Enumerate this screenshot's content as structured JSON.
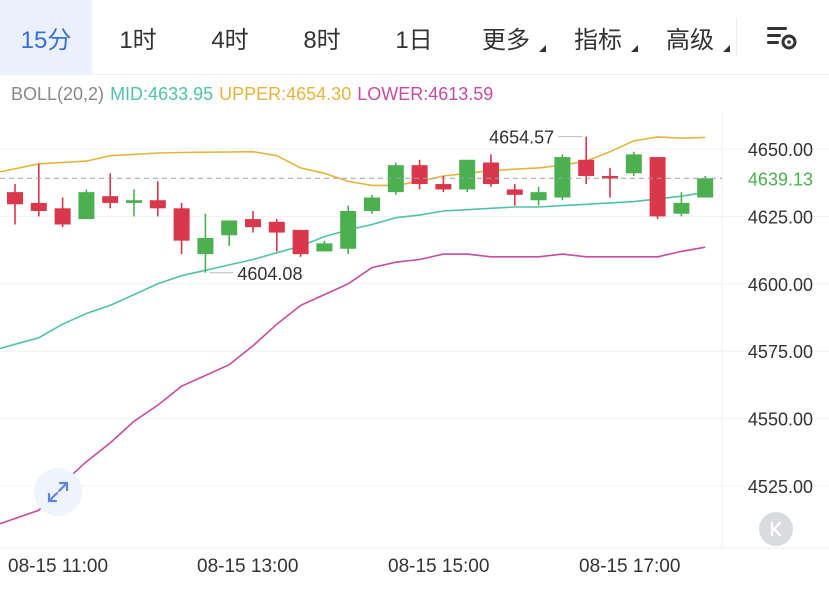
{
  "tabs": [
    {
      "label": "15分",
      "active": true,
      "dropdown": false
    },
    {
      "label": "1时",
      "active": false,
      "dropdown": false
    },
    {
      "label": "4时",
      "active": false,
      "dropdown": false
    },
    {
      "label": "8时",
      "active": false,
      "dropdown": false
    },
    {
      "label": "1日",
      "active": false,
      "dropdown": false
    },
    {
      "label": "更多",
      "active": false,
      "dropdown": true
    },
    {
      "label": "指标",
      "active": false,
      "dropdown": true
    },
    {
      "label": "高级",
      "active": false,
      "dropdown": true
    }
  ],
  "settings_icon": "chart-settings-icon",
  "indicator": {
    "name": "BOLL(20,2)",
    "mid": "MID:4633.95",
    "upper": "UPPER:4654.30",
    "lower": "LOWER:4613.59"
  },
  "colors": {
    "up": "#4caf50",
    "down": "#d9374b",
    "mid": "#4fc3a9",
    "upper": "#e8b33c",
    "lower": "#c84aa3",
    "active_tab": "#3b6fd8",
    "price_badge_text": "#4caf50"
  },
  "expand_icon": "expand-arrows-icon",
  "k_button": {
    "label": "K",
    "icon": "k-chevron-icon"
  },
  "chart_data": {
    "type": "candlestick",
    "y_ticks": [
      "4650.00",
      "4625.00",
      "4600.00",
      "4575.00",
      "4550.00",
      "4525.00"
    ],
    "y_tick_values": [
      4650,
      4625,
      4600,
      4575,
      4550,
      4525
    ],
    "ylim": [
      4510,
      4665
    ],
    "x_labels": [
      "08-15 11:00",
      "08-15 13:00",
      "08-15 15:00",
      "08-15 17:00"
    ],
    "x_label_index": [
      0,
      8,
      16,
      24
    ],
    "last_price": "4639.13",
    "last_price_value": 4639.13,
    "annotations": {
      "high": {
        "text": "4654.57",
        "index": 24,
        "value": 4654.57
      },
      "low": {
        "text": "4604.08",
        "index": 8,
        "value": 4604.08
      }
    },
    "candles": [
      {
        "o": 4634.0,
        "h": 4637.0,
        "l": 4622.0,
        "c": 4629.5
      },
      {
        "o": 4630.0,
        "h": 4644.5,
        "l": 4625.0,
        "c": 4627.0
      },
      {
        "o": 4628.0,
        "h": 4632.0,
        "l": 4621.0,
        "c": 4622.0
      },
      {
        "o": 4624.0,
        "h": 4635.0,
        "l": 4624.0,
        "c": 4634.0
      },
      {
        "o": 4632.5,
        "h": 4641.0,
        "l": 4628.0,
        "c": 4630.0
      },
      {
        "o": 4630.0,
        "h": 4635.0,
        "l": 4625.0,
        "c": 4631.0
      },
      {
        "o": 4631.0,
        "h": 4638.0,
        "l": 4625.0,
        "c": 4628.0
      },
      {
        "o": 4628.0,
        "h": 4630.0,
        "l": 4611.0,
        "c": 4616.0
      },
      {
        "o": 4611.0,
        "h": 4626.0,
        "l": 4604.08,
        "c": 4617.0
      },
      {
        "o": 4618.0,
        "h": 4623.0,
        "l": 4614.0,
        "c": 4623.5
      },
      {
        "o": 4624.0,
        "h": 4627.0,
        "l": 4619.0,
        "c": 4621.0
      },
      {
        "o": 4623.0,
        "h": 4624.0,
        "l": 4612.0,
        "c": 4619.0
      },
      {
        "o": 4620.0,
        "h": 4620.0,
        "l": 4610.0,
        "c": 4611.0
      },
      {
        "o": 4612.0,
        "h": 4616.0,
        "l": 4612.0,
        "c": 4615.0
      },
      {
        "o": 4613.0,
        "h": 4629.0,
        "l": 4611.0,
        "c": 4627.0
      },
      {
        "o": 4627.0,
        "h": 4633.0,
        "l": 4626.0,
        "c": 4632.0
      },
      {
        "o": 4634.0,
        "h": 4645.0,
        "l": 4633.0,
        "c": 4644.0
      },
      {
        "o": 4644.0,
        "h": 4646.0,
        "l": 4635.0,
        "c": 4637.0
      },
      {
        "o": 4637.0,
        "h": 4640.0,
        "l": 4634.0,
        "c": 4635.0
      },
      {
        "o": 4635.0,
        "h": 4646.0,
        "l": 4634.0,
        "c": 4646.0
      },
      {
        "o": 4645.0,
        "h": 4648.0,
        "l": 4636.0,
        "c": 4637.0
      },
      {
        "o": 4635.0,
        "h": 4637.0,
        "l": 4629.0,
        "c": 4633.0
      },
      {
        "o": 4631.0,
        "h": 4636.0,
        "l": 4629.0,
        "c": 4634.0
      },
      {
        "o": 4632.0,
        "h": 4648.0,
        "l": 4631.0,
        "c": 4647.0
      },
      {
        "o": 4646.0,
        "h": 4654.57,
        "l": 4637.0,
        "c": 4640.0
      },
      {
        "o": 4640.0,
        "h": 4643.0,
        "l": 4632.0,
        "c": 4639.0
      },
      {
        "o": 4641.0,
        "h": 4649.0,
        "l": 4640.0,
        "c": 4648.0
      },
      {
        "o": 4647.0,
        "h": 4647.0,
        "l": 4624.0,
        "c": 4625.0
      },
      {
        "o": 4626.0,
        "h": 4634.0,
        "l": 4625.0,
        "c": 4630.0
      },
      {
        "o": 4632.0,
        "h": 4640.0,
        "l": 4632.0,
        "c": 4639.13
      }
    ],
    "series": [
      {
        "name": "UPPER",
        "values": [
          4641.5,
          4644.5,
          4645.0,
          4645.5,
          4647.5,
          4648.0,
          4648.5,
          4648.7,
          4648.8,
          4648.9,
          4649.0,
          4647.5,
          4643.0,
          4641.0,
          4638.0,
          4636.5,
          4636.5,
          4638.0,
          4640.0,
          4641.0,
          4642.0,
          4642.5,
          4643.0,
          4644.0,
          4645.5,
          4649.0,
          4653.0,
          4654.5,
          4654.0,
          4654.3
        ]
      },
      {
        "name": "MID",
        "values": [
          4576.0,
          4580.0,
          4585.0,
          4589.0,
          4592.0,
          4596.0,
          4600.0,
          4603.0,
          4605.0,
          4607.0,
          4609.0,
          4611.5,
          4614.0,
          4617.5,
          4620.0,
          4622.0,
          4624.5,
          4625.5,
          4627.0,
          4627.5,
          4628.0,
          4628.5,
          4628.5,
          4629.0,
          4629.5,
          4630.0,
          4630.5,
          4631.5,
          4632.5,
          4633.95
        ]
      },
      {
        "name": "LOWER",
        "values": [
          4511.0,
          4516.0,
          4526.0,
          4534.0,
          4541.0,
          4549.0,
          4555.0,
          4562.0,
          4566.0,
          4570.0,
          4577.0,
          4585.0,
          4592.0,
          4596.0,
          4600.0,
          4606.0,
          4608.0,
          4609.0,
          4611.0,
          4611.0,
          4610.0,
          4610.0,
          4610.0,
          4611.0,
          4610.0,
          4610.0,
          4610.0,
          4610.0,
          4612.0,
          4613.59
        ]
      }
    ]
  }
}
